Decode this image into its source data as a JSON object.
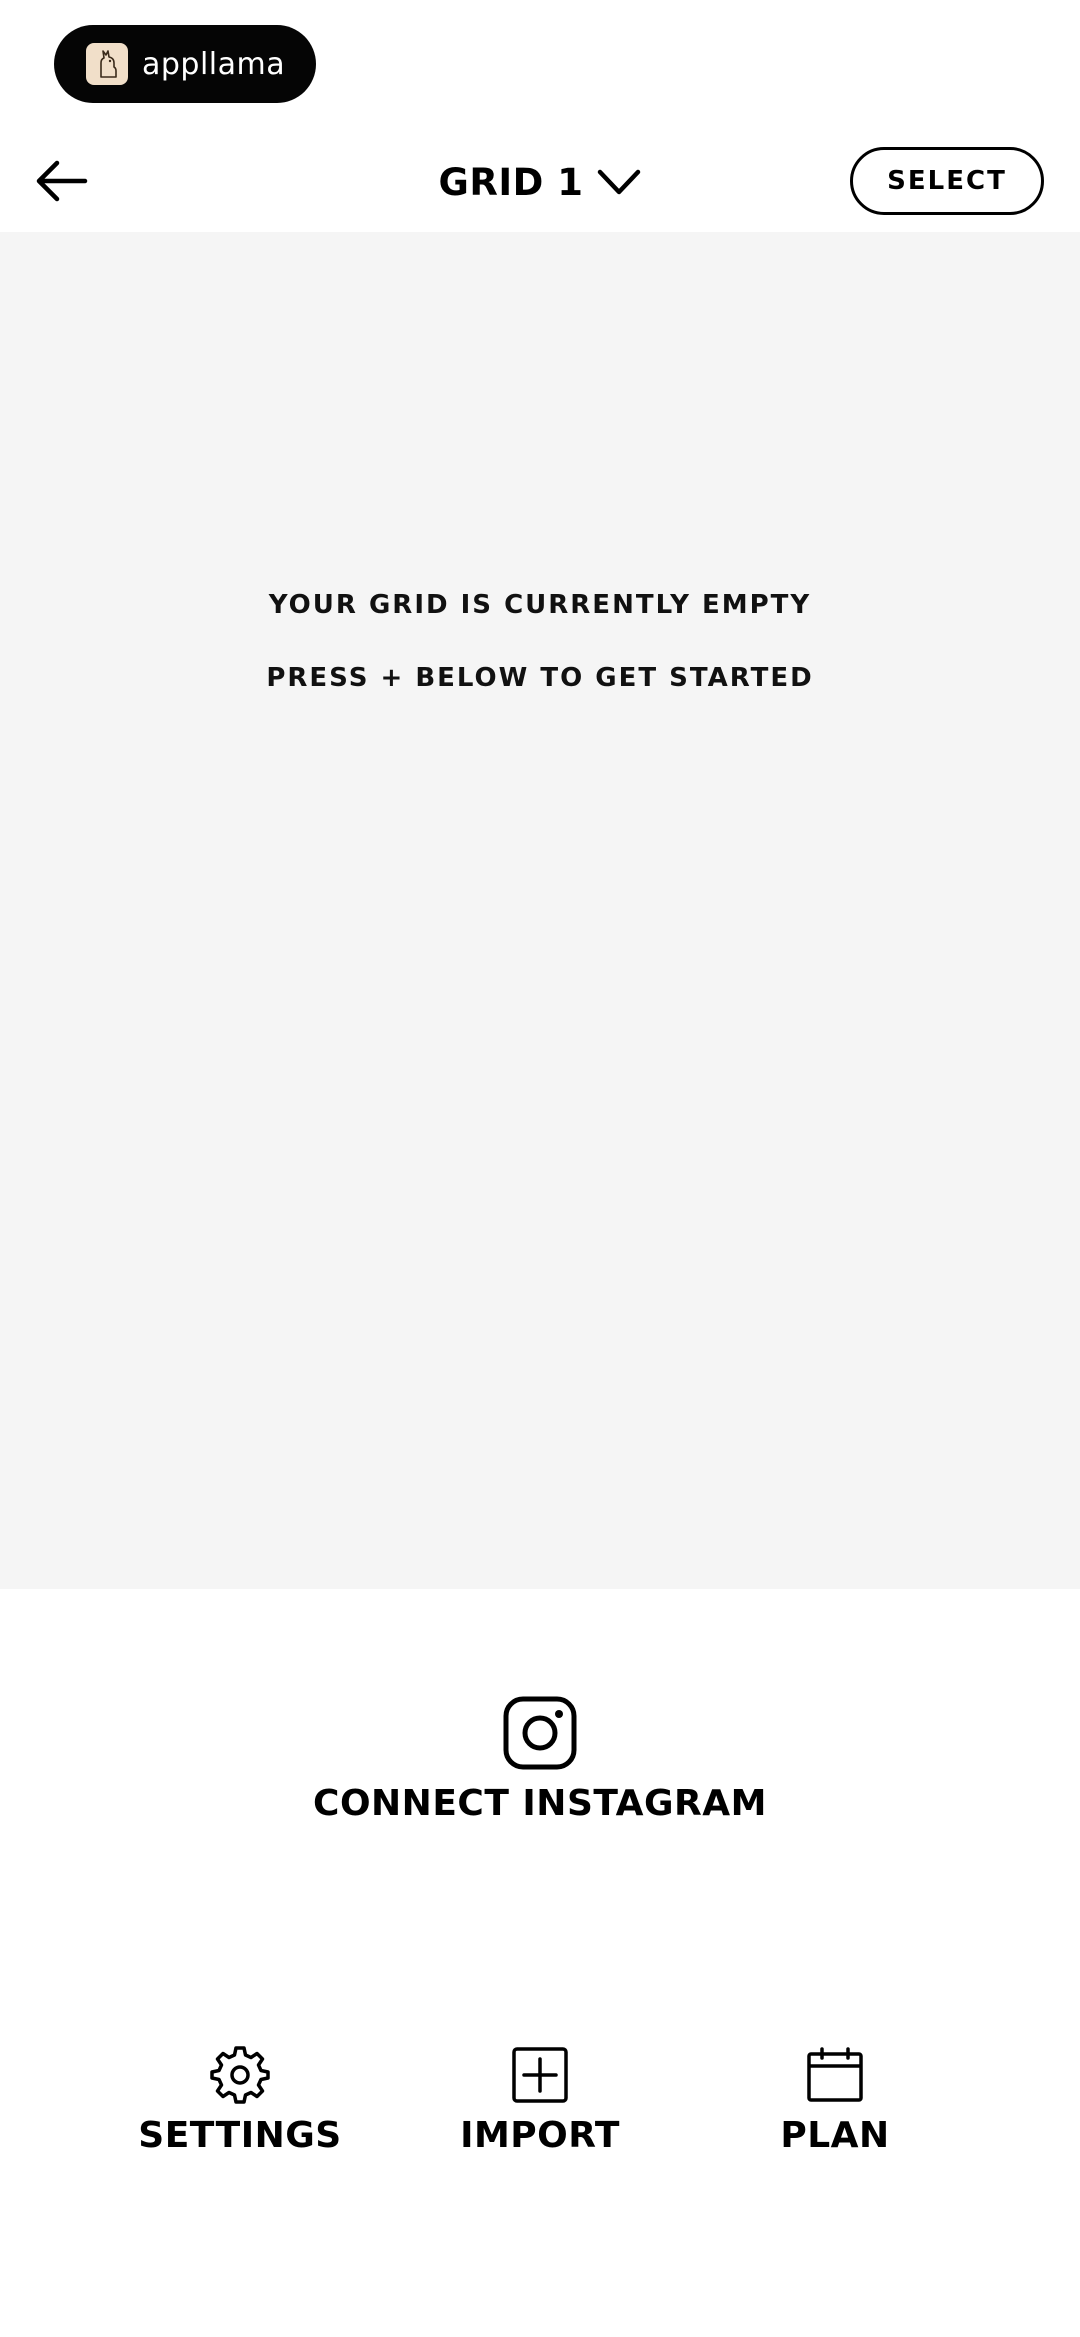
{
  "brand": {
    "name": "appllama"
  },
  "header": {
    "grid_title": "GRID 1",
    "select_label": "SELECT"
  },
  "grid": {
    "empty_message": "YOUR GRID IS CURRENTLY EMPTY",
    "empty_hint": "PRESS + BELOW TO GET STARTED"
  },
  "connect": {
    "label": "CONNECT INSTAGRAM"
  },
  "actions": [
    {
      "label": "SETTINGS",
      "icon": "gear-icon"
    },
    {
      "label": "IMPORT",
      "icon": "plus-square-icon"
    },
    {
      "label": "PLAN",
      "icon": "calendar-icon"
    }
  ],
  "colors": {
    "pill_background": "#050505",
    "grid_background": "#f5f5f5",
    "logo_background": "#f1dfc9",
    "text": "#000000"
  }
}
